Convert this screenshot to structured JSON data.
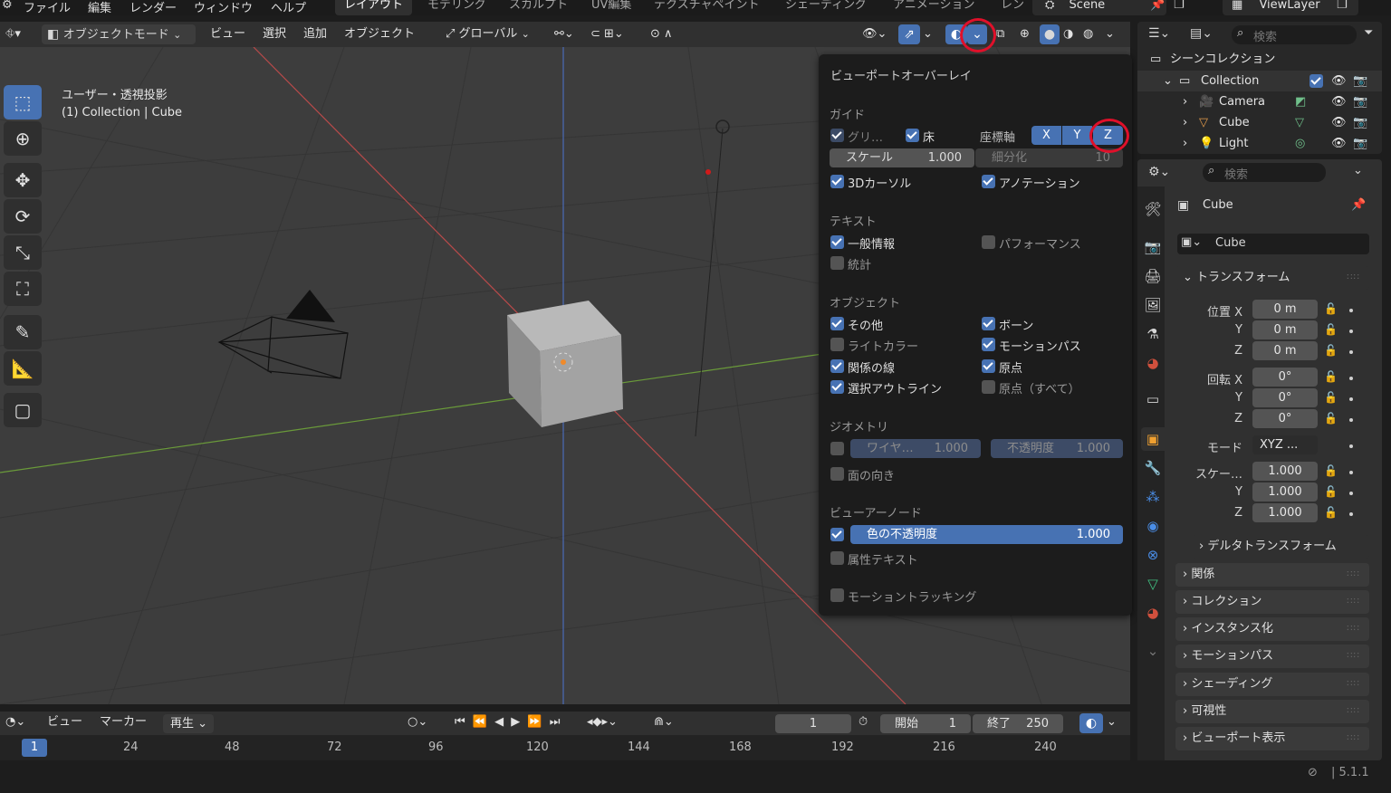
{
  "menu": [
    "ファイル",
    "編集",
    "レンダー",
    "ウィンドウ",
    "ヘルプ"
  ],
  "workspaces": [
    "レイアウト",
    "モデリング",
    "スカルプト",
    "UV編集",
    "テクスチャペイント",
    "シェーディング",
    "アニメーション",
    "レン"
  ],
  "scene": "Scene",
  "view_layer": "ViewLayer",
  "vp_header": {
    "mode": "オブジェクトモード",
    "view": "ビュー",
    "select": "選択",
    "add": "追加",
    "object": "オブジェクト",
    "orientation": "グローバル"
  },
  "viewport_info": {
    "line1": "ユーザー・透視投影",
    "line2": "(1) Collection | Cube"
  },
  "overlay": {
    "title": "ビューポートオーバーレイ",
    "guides": "ガイド",
    "grid": "グリ…",
    "floor": "床",
    "axes": "座標軸",
    "ax_x": "X",
    "ax_y": "Y",
    "ax_z": "Z",
    "scale_label": "スケール",
    "scale_value": "1.000",
    "subdiv_label": "細分化",
    "subdiv_value": "10",
    "cursor3d": "3Dカーソル",
    "annotation": "アノテーション",
    "text": "テキスト",
    "general": "一般情報",
    "performance": "パフォーマンス",
    "stats": "統計",
    "objects": "オブジェクト",
    "extras": "その他",
    "bones": "ボーン",
    "light_colors": "ライトカラー",
    "motion_paths": "モーションパス",
    "relations": "関係の線",
    "origins": "原点",
    "outline": "選択アウトライン",
    "origins_all": "原点（すべて）",
    "geometry": "ジオメトリ",
    "wire_label": "ワイヤ…",
    "wire_value": "1.000",
    "opacity_label": "不透明度",
    "opacity_value": "1.000",
    "face_orient": "面の向き",
    "viewer_node": "ビューアーノード",
    "color_opacity_label": "色の不透明度",
    "color_opacity_value": "1.000",
    "attr_text": "属性テキスト",
    "motion_tracking": "モーショントラッキング"
  },
  "outliner": {
    "search": "検索",
    "scene_collection": "シーンコレクション",
    "collection": "Collection",
    "items": [
      "Camera",
      "Cube",
      "Light"
    ]
  },
  "properties": {
    "search": "検索",
    "object_name": "Cube",
    "datablock": "Cube",
    "transform": "トランスフォーム",
    "loc_label": "位置 X",
    "loc": [
      "0 m",
      "0 m",
      "0 m"
    ],
    "rot_label": "回転 X",
    "rot": [
      "0°",
      "0°",
      "0°"
    ],
    "mode_label": "モード",
    "mode_value": "XYZ ...",
    "scale_label": "スケー…",
    "scale": [
      "1.000",
      "1.000",
      "1.000"
    ],
    "y": "Y",
    "z": "Z",
    "delta": "デルタトランスフォーム",
    "panels": [
      "関係",
      "コレクション",
      "インスタンス化",
      "モーションパス",
      "シェーディング",
      "可視性",
      "ビューポート表示"
    ]
  },
  "timeline": {
    "view": "ビュー",
    "marker": "マーカー",
    "playback": "再生",
    "current": "1",
    "start_label": "開始",
    "start": "1",
    "end_label": "終了",
    "end": "250",
    "ticks": [
      "1",
      "24",
      "48",
      "72",
      "96",
      "120",
      "144",
      "168",
      "192",
      "216",
      "240"
    ]
  },
  "version": "5.1.1",
  "accent": "#4772b3",
  "highlight": "#e0102a"
}
